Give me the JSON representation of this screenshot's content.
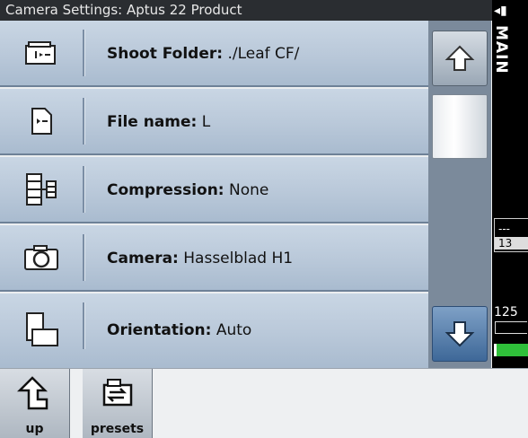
{
  "window": {
    "title": "Camera Settings: Aptus 22 Product"
  },
  "settings": [
    {
      "label": "Shoot Folder:",
      "value": "./Leaf CF/",
      "icon": "folder-icon"
    },
    {
      "label": "File name:",
      "value": "L",
      "icon": "file-icon"
    },
    {
      "label": "Compression:",
      "value": "None",
      "icon": "compression-icon"
    },
    {
      "label": "Camera:",
      "value": "Hasselblad H1",
      "icon": "camera-icon"
    },
    {
      "label": "Orientation:",
      "value": "Auto",
      "icon": "orientation-icon"
    }
  ],
  "sidebar": {
    "mode_label": "MAIN",
    "folder_top": "---",
    "folder_count": "13",
    "shutter": "125"
  },
  "bottom": {
    "up_label": "up",
    "presets_label": "presets"
  },
  "colors": {
    "accent": "#4a74a3",
    "title_bg": "#2a2d31",
    "battery": "#2fc03a"
  }
}
